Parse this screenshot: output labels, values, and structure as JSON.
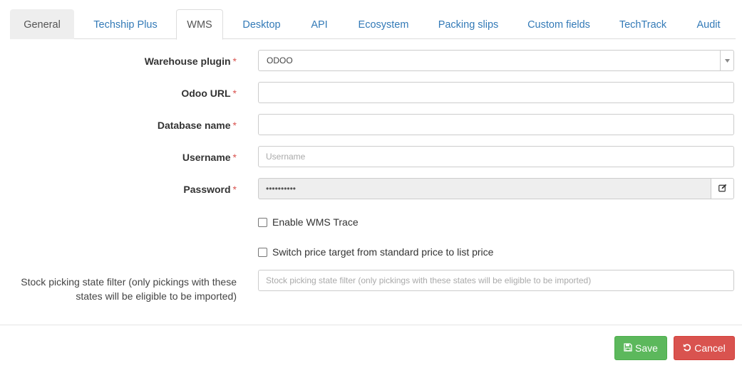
{
  "tabs": [
    {
      "label": "General"
    },
    {
      "label": "Techship Plus"
    },
    {
      "label": "WMS"
    },
    {
      "label": "Desktop"
    },
    {
      "label": "API"
    },
    {
      "label": "Ecosystem"
    },
    {
      "label": "Packing slips"
    },
    {
      "label": "Custom fields"
    },
    {
      "label": "TechTrack"
    },
    {
      "label": "Audit"
    }
  ],
  "form": {
    "warehouse_plugin": {
      "label": "Warehouse plugin",
      "value": "ODOO"
    },
    "odoo_url": {
      "label": "Odoo URL",
      "value": ""
    },
    "database_name": {
      "label": "Database name",
      "value": ""
    },
    "username": {
      "label": "Username",
      "placeholder": "Username",
      "value": ""
    },
    "password": {
      "label": "Password",
      "masked_value": "••••••••••"
    },
    "required_marker": "*",
    "enable_wms_trace": {
      "label": "Enable WMS Trace",
      "checked": false
    },
    "switch_price_target": {
      "label": "Switch price target from standard price to list price",
      "checked": false
    },
    "stock_filter": {
      "label_line1": "Stock picking state filter (only pickings with these",
      "label_line2": "states will be eligible to be imported)",
      "placeholder": "Stock picking state filter (only pickings with these states will be eligible to be imported)"
    }
  },
  "footer": {
    "save_label": "Save",
    "cancel_label": "Cancel"
  },
  "icons": {
    "select_arrow": "caret-down-icon",
    "password_edit": "edit-icon",
    "save": "floppy-disk-icon",
    "cancel": "undo-icon"
  },
  "colors": {
    "link": "#337ab7",
    "required": "#d9534f",
    "save": "#5cb85c",
    "cancel": "#d9534f"
  }
}
